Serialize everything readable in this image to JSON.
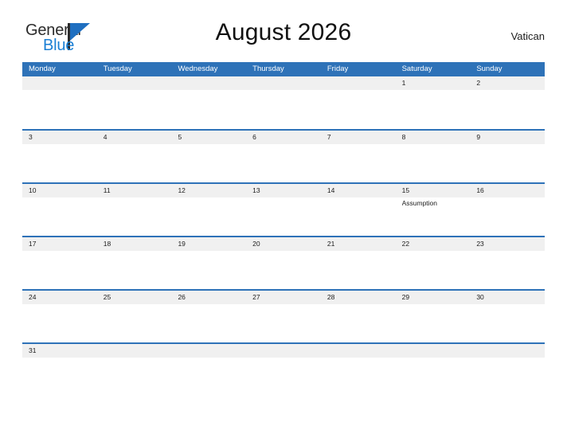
{
  "brand": {
    "name_part1": "General",
    "name_part2": "Blue",
    "flag_icon": "flag-icon",
    "color_dark": "#2b2b2b",
    "color_blue": "#1a7fd4"
  },
  "header": {
    "title": "August 2026",
    "region": "Vatican"
  },
  "theme": {
    "header_blue": "#2e72b8",
    "row_divider_blue": "#2e72b8",
    "date_band_gray": "#f0f0f0",
    "text_dark": "#1c1c1c",
    "page_background": "#ffffff"
  },
  "calendar": {
    "month": "August",
    "year": "2026",
    "weekdays": [
      "Monday",
      "Tuesday",
      "Wednesday",
      "Thursday",
      "Friday",
      "Saturday",
      "Sunday"
    ],
    "weeks": [
      [
        {
          "date": "",
          "event": ""
        },
        {
          "date": "",
          "event": ""
        },
        {
          "date": "",
          "event": ""
        },
        {
          "date": "",
          "event": ""
        },
        {
          "date": "",
          "event": ""
        },
        {
          "date": "1",
          "event": ""
        },
        {
          "date": "2",
          "event": ""
        }
      ],
      [
        {
          "date": "3",
          "event": ""
        },
        {
          "date": "4",
          "event": ""
        },
        {
          "date": "5",
          "event": ""
        },
        {
          "date": "6",
          "event": ""
        },
        {
          "date": "7",
          "event": ""
        },
        {
          "date": "8",
          "event": ""
        },
        {
          "date": "9",
          "event": ""
        }
      ],
      [
        {
          "date": "10",
          "event": ""
        },
        {
          "date": "11",
          "event": ""
        },
        {
          "date": "12",
          "event": ""
        },
        {
          "date": "13",
          "event": ""
        },
        {
          "date": "14",
          "event": ""
        },
        {
          "date": "15",
          "event": "Assumption"
        },
        {
          "date": "16",
          "event": ""
        }
      ],
      [
        {
          "date": "17",
          "event": ""
        },
        {
          "date": "18",
          "event": ""
        },
        {
          "date": "19",
          "event": ""
        },
        {
          "date": "20",
          "event": ""
        },
        {
          "date": "21",
          "event": ""
        },
        {
          "date": "22",
          "event": ""
        },
        {
          "date": "23",
          "event": ""
        }
      ],
      [
        {
          "date": "24",
          "event": ""
        },
        {
          "date": "25",
          "event": ""
        },
        {
          "date": "26",
          "event": ""
        },
        {
          "date": "27",
          "event": ""
        },
        {
          "date": "28",
          "event": ""
        },
        {
          "date": "29",
          "event": ""
        },
        {
          "date": "30",
          "event": ""
        }
      ],
      [
        {
          "date": "31",
          "event": ""
        },
        {
          "date": "",
          "event": ""
        },
        {
          "date": "",
          "event": ""
        },
        {
          "date": "",
          "event": ""
        },
        {
          "date": "",
          "event": ""
        },
        {
          "date": "",
          "event": ""
        },
        {
          "date": "",
          "event": ""
        }
      ]
    ]
  }
}
